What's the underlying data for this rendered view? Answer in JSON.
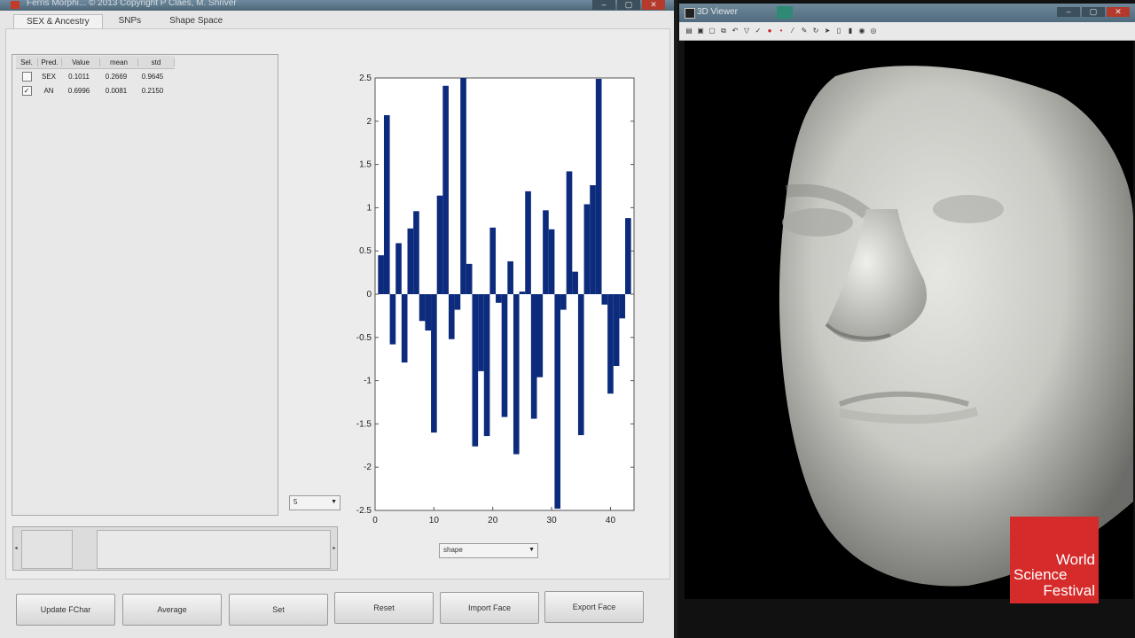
{
  "window": {
    "title": "Ferris Morphi... © 2013 Copyright P Claes, M. Shriver",
    "buttons": [
      "–",
      "▢",
      "✕"
    ]
  },
  "tabs": [
    "SEX & Ancestry",
    "SNPs",
    "Shape Space"
  ],
  "table": {
    "headers": [
      "Sel.",
      "Pred.",
      "Value",
      "mean",
      "std"
    ],
    "rows": [
      {
        "checked": false,
        "pred": "SEX",
        "value": "0.1011",
        "mean": "0.2669",
        "std": "0.9645"
      },
      {
        "checked": true,
        "pred": "AN",
        "value": "0.6996",
        "mean": "0.0081",
        "std": "0.2150"
      }
    ]
  },
  "popup_small": {
    "value": "5"
  },
  "popup_shape": {
    "value": "shape"
  },
  "buttons": [
    "Update FChar",
    "Average",
    "Set",
    "Reset",
    "Import Face",
    "Export Face"
  ],
  "viewer": {
    "title": "3D Viewer"
  },
  "logo": {
    "lines": [
      "World",
      "Science",
      "Festival"
    ]
  },
  "chart_data": {
    "type": "bar",
    "x": [
      1,
      2,
      3,
      4,
      5,
      6,
      7,
      8,
      9,
      10,
      11,
      12,
      13,
      14,
      15,
      16,
      17,
      18,
      19,
      20,
      21,
      22,
      23,
      24,
      25,
      26,
      27,
      28,
      29,
      30,
      31,
      32,
      33,
      34,
      35,
      36,
      37,
      38,
      39,
      40,
      41,
      42,
      43
    ],
    "values": [
      0.45,
      2.07,
      -0.58,
      0.59,
      -0.79,
      0.76,
      0.96,
      -0.31,
      -0.42,
      -1.6,
      1.14,
      2.41,
      -0.52,
      -0.18,
      2.5,
      0.35,
      -1.76,
      -0.89,
      -1.64,
      0.77,
      -0.1,
      -1.42,
      0.38,
      -1.85,
      0.03,
      1.19,
      -1.44,
      -0.96,
      0.97,
      0.75,
      -2.48,
      -0.18,
      1.42,
      0.26,
      -1.63,
      1.04,
      1.26,
      2.49,
      -0.12,
      -1.15,
      -0.83,
      -0.28,
      0.88
    ],
    "xlim": [
      0,
      44
    ],
    "ylim": [
      -2.5,
      2.5
    ],
    "xticks": [
      0,
      10,
      20,
      30,
      40
    ],
    "yticks": [
      2.5,
      2,
      1.5,
      1,
      0.5,
      0,
      -0.5,
      -1,
      -1.5,
      -2,
      -2.5
    ],
    "ytick_labels": [
      "2.5",
      "2",
      "1.5",
      "1",
      "0.5",
      "0",
      "-0.5",
      "-1",
      "-1.5",
      "-2",
      "-2.5"
    ],
    "bar_color": "#0d2b7c",
    "grid": false
  }
}
